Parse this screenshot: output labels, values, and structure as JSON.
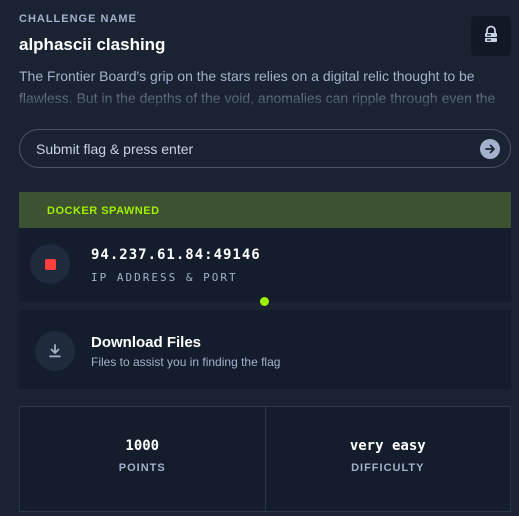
{
  "header": {
    "section_label": "CHALLENGE NAME",
    "title": "alphascii clashing",
    "description": "The Frontier Board's grip on the stars relies on a digital relic thought to be flawless. But in the depths of the void, anomalies can ripple through even the"
  },
  "lock_button": {
    "icon": "lock-icon"
  },
  "flag": {
    "placeholder": "Submit flag & press enter",
    "value": "",
    "submit_icon": "arrow-right-icon"
  },
  "docker": {
    "status": "DOCKER SPAWNED",
    "ip_port": "94.237.61.84:49146",
    "ip_label": "IP ADDRESS & PORT",
    "stop_icon": "stop-icon",
    "status_color": "#9fef00"
  },
  "download": {
    "title": "Download Files",
    "subtitle": "Files to assist you in finding the flag",
    "icon": "download-icon"
  },
  "stats": {
    "points_value": "1000",
    "points_label": "POINTS",
    "difficulty_value": "very easy",
    "difficulty_label": "DIFFICULTY"
  },
  "colors": {
    "background": "#1a2332",
    "panel": "#141d2b",
    "accent_green": "#9fef00",
    "stop_red": "#ff3e3e",
    "muted_text": "#a4b1cd"
  }
}
